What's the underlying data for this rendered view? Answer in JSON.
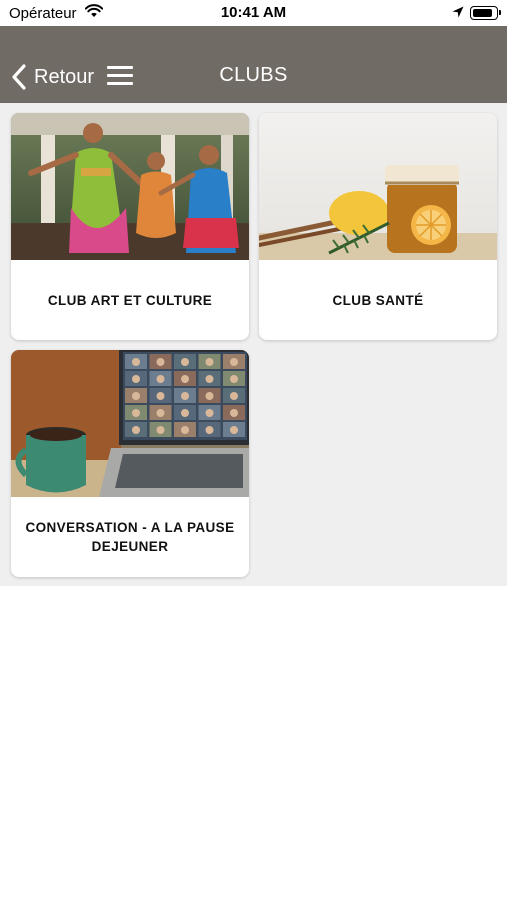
{
  "status_bar": {
    "carrier": "Opérateur",
    "time": "10:41 AM",
    "battery_level": 0.9
  },
  "nav": {
    "back_label": "Retour",
    "title": "CLUBS"
  },
  "colors": {
    "nav_background": "#716b66",
    "content_background": "#efefef",
    "card_background": "#ffffff"
  },
  "clubs": [
    {
      "label": "CLUB ART ET CULTURE",
      "image": "dancers-photo"
    },
    {
      "label": "CLUB SANTÉ",
      "image": "honey-lemon-jar-photo"
    },
    {
      "label": "CONVERSATION - A LA PAUSE DEJEUNER",
      "image": "laptop-video-call-mug-photo"
    }
  ]
}
